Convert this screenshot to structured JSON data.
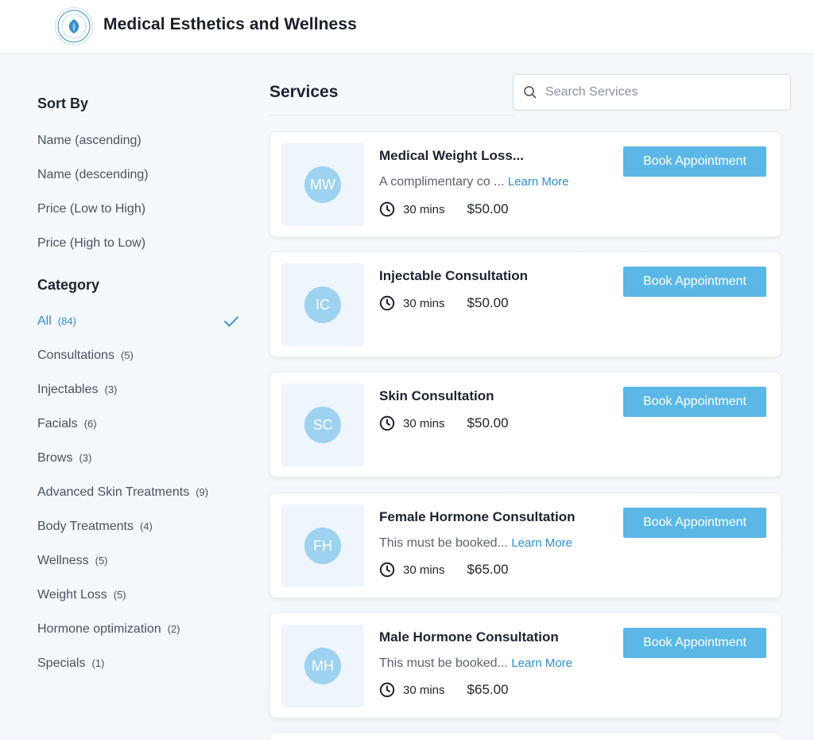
{
  "header": {
    "title": "Medical Esthetics and Wellness",
    "logo_icon": "spa-logo-icon"
  },
  "sidebar": {
    "sort_heading": "Sort By",
    "sort_options": [
      "Name (ascending)",
      "Name (descending)",
      "Price (Low to High)",
      "Price (High to Low)"
    ],
    "category_heading": "Category",
    "categories": [
      {
        "label": "All",
        "count": "(84)",
        "active": true
      },
      {
        "label": "Consultations",
        "count": "(5)"
      },
      {
        "label": "Injectables",
        "count": "(3)"
      },
      {
        "label": "Facials",
        "count": "(6)"
      },
      {
        "label": "Brows",
        "count": "(3)"
      },
      {
        "label": "Advanced Skin Treatments",
        "count": "(9)"
      },
      {
        "label": "Body Treatments",
        "count": "(4)"
      },
      {
        "label": "Wellness",
        "count": "(5)"
      },
      {
        "label": "Weight Loss",
        "count": "(5)"
      },
      {
        "label": "Hormone optimization",
        "count": "(2)"
      },
      {
        "label": "Specials",
        "count": "(1)"
      }
    ]
  },
  "main": {
    "title": "Services",
    "search": {
      "placeholder": "Search Services",
      "value": ""
    },
    "book_label": "Book Appointment",
    "learn_more_label": "Learn More",
    "services": [
      {
        "initials": "MW",
        "name": "Medical Weight Loss...",
        "description": "A complimentary co  ...",
        "duration": "30 mins",
        "price": "$50.00"
      },
      {
        "initials": "IC",
        "name": "Injectable Consultation",
        "description": "",
        "duration": "30 mins",
        "price": "$50.00"
      },
      {
        "initials": "SC",
        "name": "Skin Consultation",
        "description": "",
        "duration": "30 mins",
        "price": "$50.00"
      },
      {
        "initials": "FH",
        "name": "Female Hormone Consultation",
        "description": "This must be booked...",
        "duration": "30 mins",
        "price": "$65.00"
      },
      {
        "initials": "MH",
        "name": "Male Hormone Consultation",
        "description": "This must be booked...",
        "duration": "30 mins",
        "price": "$65.00"
      }
    ]
  },
  "colors": {
    "accent": "#2d8fd0",
    "button": "#5bb8e6",
    "avatar": "#9dd2f0",
    "thumb_bg": "#eef5fc"
  }
}
